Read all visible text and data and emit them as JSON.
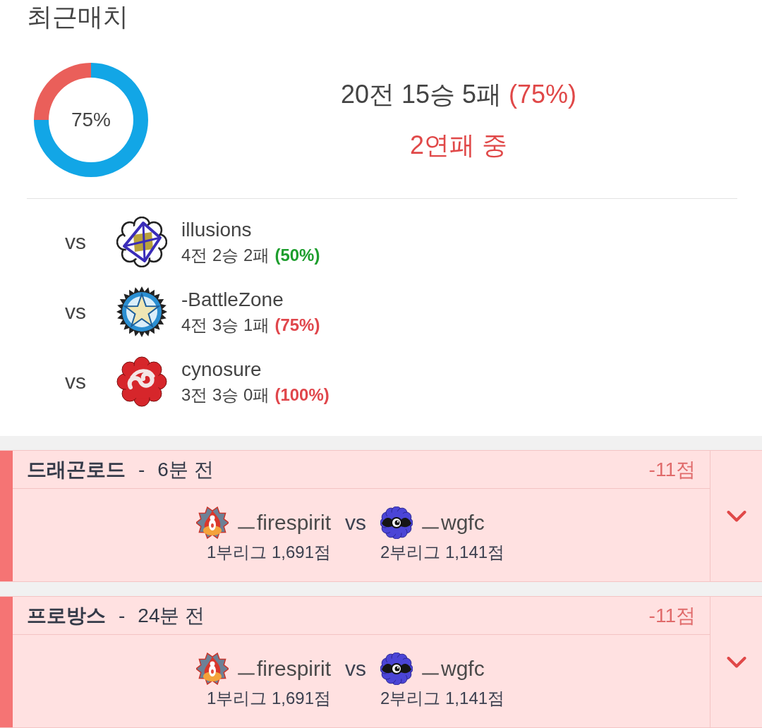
{
  "title": "최근매치",
  "summary": {
    "chart_data": {
      "type": "donut",
      "values": [
        75,
        25
      ],
      "annotations": [
        "75%"
      ]
    },
    "record": "20전 15승 5패",
    "rate": "(75%)",
    "streak": "2연패 중"
  },
  "opponents": [
    {
      "prefix": "vs",
      "kind": "crystal",
      "name": "illusions",
      "record": "4전 2승 2패",
      "rate": "(50%)",
      "color": "#1e9e2e"
    },
    {
      "prefix": "vs",
      "kind": "star",
      "name": "-BattleZone",
      "record": "4전 3승 1패",
      "rate": "(75%)",
      "color": "#e0474c"
    },
    {
      "prefix": "vs",
      "kind": "swirl",
      "name": "cynosure",
      "record": "3전 3승 0패",
      "rate": "(100%)",
      "color": "#e0474c"
    }
  ],
  "matches": [
    {
      "kind": "loss",
      "map": "드래곤로드",
      "separator": "-",
      "time": "6분 전",
      "points": "-11점",
      "expanded": false,
      "vs": "vs",
      "players": [
        {
          "kind": "flame",
          "name": "ㅡfirespirit",
          "league": "1부리그 1,691점"
        },
        {
          "kind": "eye",
          "name": "ㅡwgfc",
          "league": "2부리그 1,141점"
        }
      ]
    },
    {
      "kind": "loss",
      "map": "프로방스",
      "separator": "-",
      "time": "24분 전",
      "points": "-11점",
      "expanded": false,
      "vs": "vs",
      "players": [
        {
          "kind": "flame",
          "name": "ㅡfirespirit",
          "league": "1부리그 1,691점"
        },
        {
          "kind": "eye",
          "name": "ㅡwgfc",
          "league": "2부리그 1,141점"
        }
      ]
    }
  ]
}
